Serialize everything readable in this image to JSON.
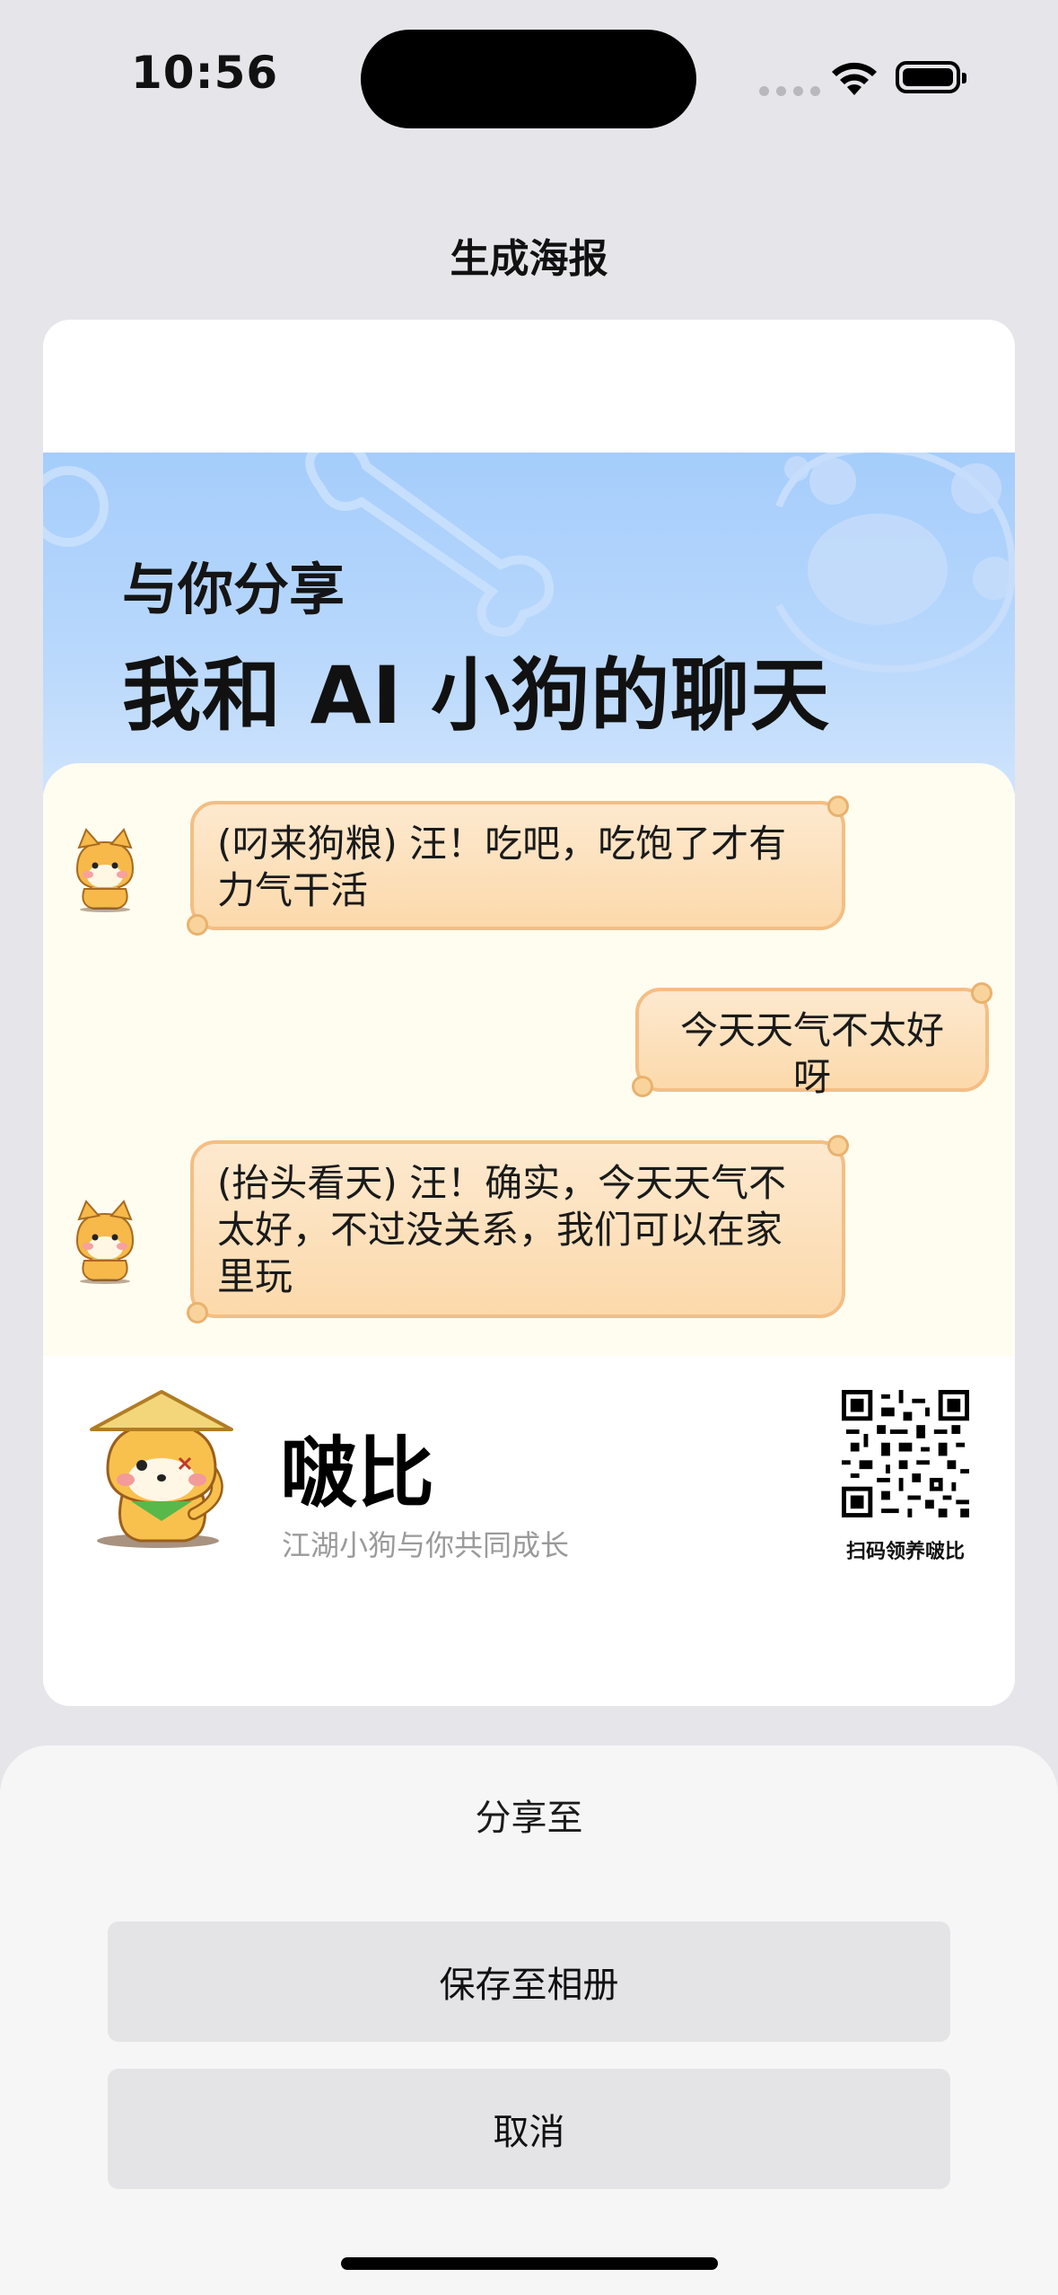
{
  "status_bar": {
    "time": "10:56"
  },
  "nav": {
    "title": "生成海报"
  },
  "poster": {
    "share_line1": "与你分享",
    "share_line2": "我和 AI 小狗的聊天",
    "messages": [
      {
        "sender": "pet",
        "text": "(叼来狗粮) 汪！吃吧，吃饱了才有力气干活"
      },
      {
        "sender": "user",
        "text": "今天天气不太好呀"
      },
      {
        "sender": "pet",
        "text": "(抬头看天) 汪！确实，今天天气不太好，不过没关系，我们可以在家里玩"
      }
    ],
    "pet_name": "啵比",
    "slogan": "江湖小狗与你共同成长",
    "qr_caption": "扫码领养啵比"
  },
  "share_sheet": {
    "title": "分享至",
    "save_label": "保存至相册",
    "cancel_label": "取消"
  },
  "colors": {
    "header_blue": "#a5cdfb",
    "bubble_fill": "#fcd9ab",
    "bubble_border": "#f4be84",
    "chat_bg": "#fffdf0"
  }
}
